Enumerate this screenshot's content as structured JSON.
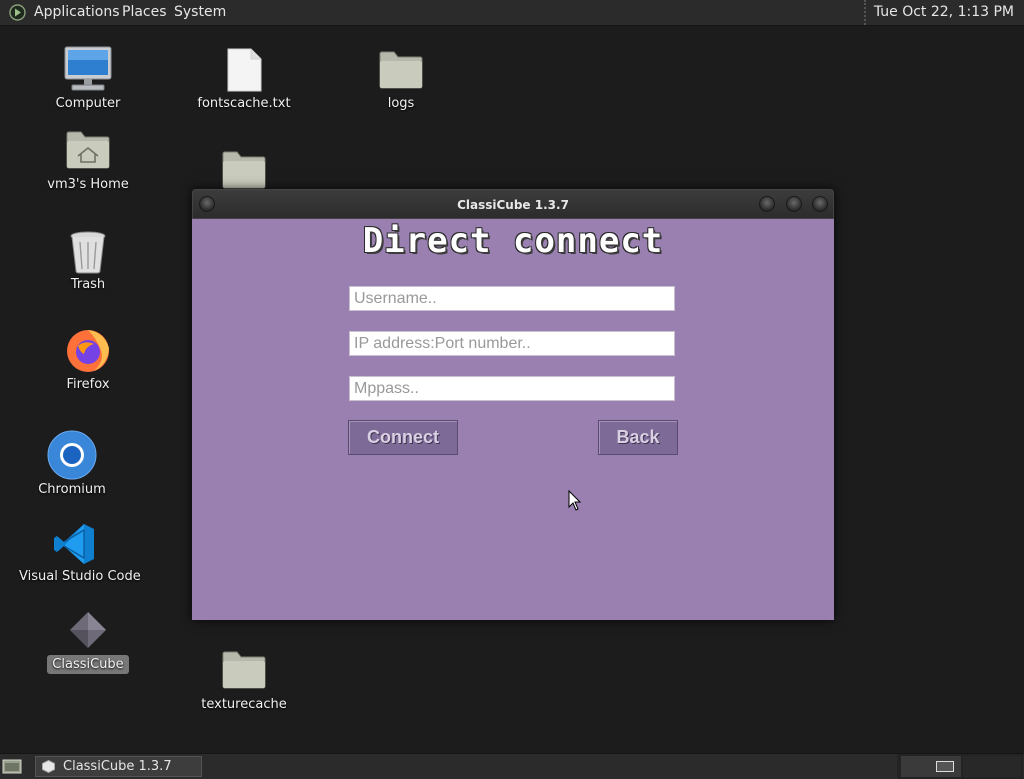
{
  "top_panel": {
    "menus": [
      "Applications",
      "Places",
      "System"
    ],
    "clock": "Tue Oct 22, 1:13 PM"
  },
  "desktop_icons": [
    {
      "label": "Computer",
      "icon": "computer-icon"
    },
    {
      "label": "vm3's Home",
      "icon": "home-folder-icon"
    },
    {
      "label": "Trash",
      "icon": "trash-icon"
    },
    {
      "label": "Firefox",
      "icon": "firefox-icon"
    },
    {
      "label": "Chromium",
      "icon": "chromium-icon"
    },
    {
      "label": "Visual Studio Code",
      "icon": "vscode-icon"
    },
    {
      "label": "ClassiCube",
      "icon": "classicube-icon",
      "selected": true
    },
    {
      "label": "fontscache.txt",
      "icon": "text-file-icon"
    },
    {
      "label": "logs",
      "icon": "folder-icon"
    },
    {
      "label": "",
      "icon": "folder-icon"
    },
    {
      "label": "texturecache",
      "icon": "folder-icon"
    }
  ],
  "window": {
    "title": "ClassiCube 1.3.7",
    "heading": "Direct connect",
    "fields": {
      "username_placeholder": "Username..",
      "ip_placeholder": "IP address:Port number..",
      "mppass_placeholder": "Mppass.."
    },
    "buttons": {
      "connect": "Connect",
      "back": "Back"
    },
    "background_color": "#9980b0"
  },
  "taskbar": {
    "task_label": "ClassiCube 1.3.7"
  }
}
